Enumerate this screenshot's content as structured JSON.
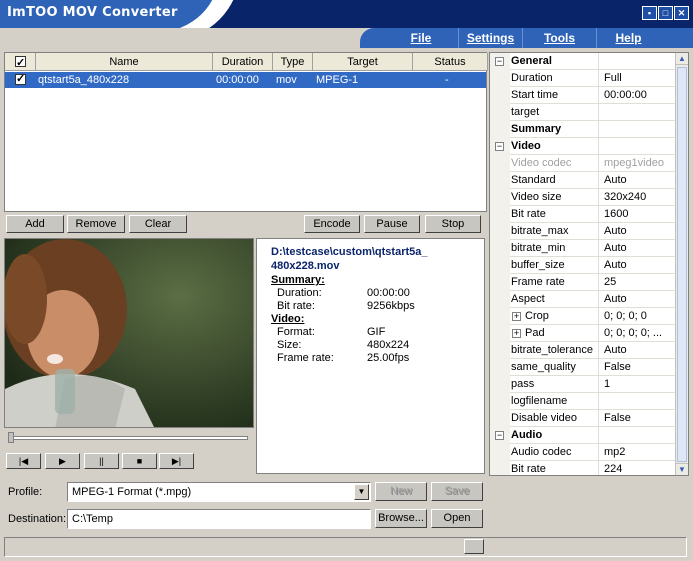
{
  "window": {
    "title": "ImTOO MOV Converter",
    "minimize_glyph": "▪",
    "maximize_glyph": "□",
    "close_glyph": "✕"
  },
  "menu": [
    "File",
    "Settings",
    "Tools",
    "Help"
  ],
  "file_list": {
    "columns": [
      "Name",
      "Duration",
      "Type",
      "Target",
      "Status"
    ],
    "rows": [
      {
        "name": "qtstart5a_480x228",
        "duration": "00:00:00",
        "type": "mov",
        "target": "MPEG-1",
        "status": "-"
      }
    ]
  },
  "list_buttons": {
    "add": "Add",
    "remove": "Remove",
    "clear": "Clear",
    "encode": "Encode",
    "pause": "Pause",
    "stop": "Stop"
  },
  "player": {
    "controls": [
      "rewind-icon",
      "play-icon",
      "pause-icon",
      "stop-icon",
      "forward-icon"
    ],
    "glyphs": {
      "rewind": "|◀",
      "play": "▶",
      "pause": "||",
      "stop": "■",
      "forward": "▶|"
    }
  },
  "file_info": {
    "path_line1": "D:\\testcase\\custom\\qtstart5a_",
    "path_line2": "480x228.mov",
    "summary_label": "Summary:",
    "duration_label": "Duration:",
    "duration": "00:00:00",
    "bitrate_label": "Bit rate:",
    "bitrate": "9256kbps",
    "video_label": "Video:",
    "format_label": "Format:",
    "format": "GIF",
    "size_label": "Size:",
    "size": "480x224",
    "framerate_label": "Frame rate:",
    "framerate": "25.00fps"
  },
  "properties": [
    {
      "name": "General",
      "value": "",
      "kind": "section",
      "toggle": "−"
    },
    {
      "name": "Duration",
      "value": "Full"
    },
    {
      "name": "Start time",
      "value": "00:00:00"
    },
    {
      "name": "target",
      "value": ""
    },
    {
      "name": "Summary",
      "value": "",
      "kind": "bold"
    },
    {
      "name": "Video",
      "value": "",
      "kind": "section",
      "toggle": "−"
    },
    {
      "name": "Video codec",
      "value": "mpeg1video",
      "kind": "disabled"
    },
    {
      "name": "Standard",
      "value": "Auto"
    },
    {
      "name": "Video size",
      "value": "320x240"
    },
    {
      "name": "Bit rate",
      "value": "1600"
    },
    {
      "name": "bitrate_max",
      "value": "Auto"
    },
    {
      "name": "bitrate_min",
      "value": "Auto"
    },
    {
      "name": "buffer_size",
      "value": "Auto"
    },
    {
      "name": "Frame rate",
      "value": "25"
    },
    {
      "name": "Aspect",
      "value": "Auto"
    },
    {
      "name": "Crop",
      "value": "0; 0; 0; 0",
      "kind": "sub",
      "toggle": "+"
    },
    {
      "name": "Pad",
      "value": "0; 0; 0; 0; ...",
      "kind": "sub",
      "toggle": "+"
    },
    {
      "name": "bitrate_tolerance",
      "value": "Auto"
    },
    {
      "name": "same_quality",
      "value": "False"
    },
    {
      "name": "pass",
      "value": "1"
    },
    {
      "name": "logfilename",
      "value": ""
    },
    {
      "name": "Disable video",
      "value": "False"
    },
    {
      "name": "Audio",
      "value": "",
      "kind": "section",
      "toggle": "−"
    },
    {
      "name": "Audio codec",
      "value": "mp2"
    },
    {
      "name": "Bit rate",
      "value": "224"
    }
  ],
  "profile": {
    "label": "Profile:",
    "value": "MPEG-1 Format  (*.mpg)",
    "new": "New",
    "save": "Save"
  },
  "destination": {
    "label": "Destination:",
    "value": "C:\\Temp",
    "browse": "Browse...",
    "open": "Open"
  }
}
